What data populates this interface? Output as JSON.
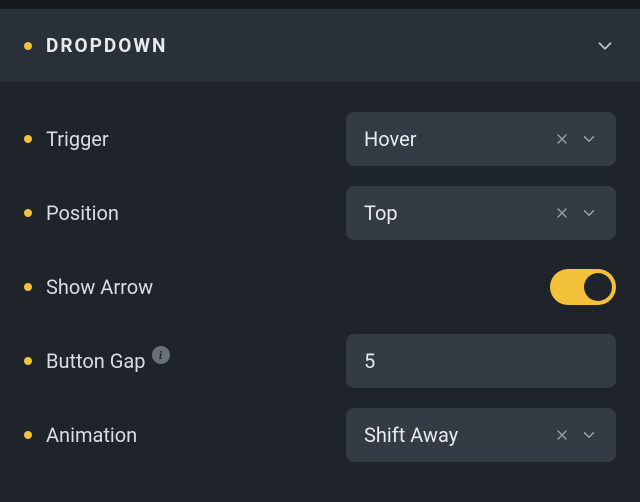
{
  "section": {
    "title": "DROPDOWN"
  },
  "rows": {
    "trigger": {
      "label": "Trigger",
      "value": "Hover"
    },
    "position": {
      "label": "Position",
      "value": "Top"
    },
    "show_arrow": {
      "label": "Show Arrow",
      "on": true
    },
    "button_gap": {
      "label": "Button Gap",
      "value": "5"
    },
    "animation": {
      "label": "Animation",
      "value": "Shift Away"
    }
  },
  "colors": {
    "accent": "#f3c13a"
  }
}
